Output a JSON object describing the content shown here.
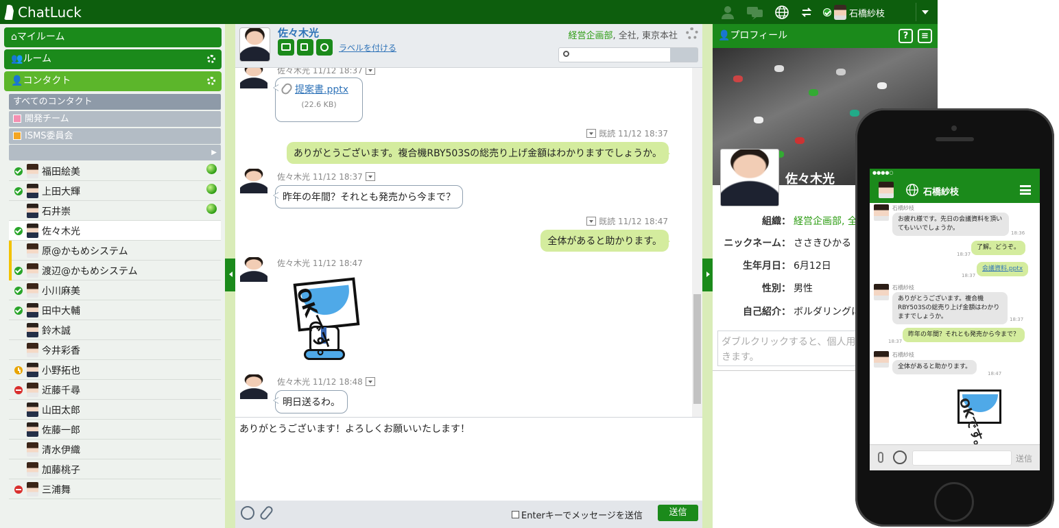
{
  "app": {
    "title": "ChatLuck"
  },
  "topbar": {
    "user_name": "石橋紗枝"
  },
  "sidebar": {
    "my_room": "マイルーム",
    "room": "ルーム",
    "contacts": "コンタクト",
    "groups": [
      {
        "label": "すべてのコンタクト",
        "color": "#8e9aa8"
      },
      {
        "label": "開発チーム",
        "color": "#f48fb1"
      },
      {
        "label": "ISMS委員会",
        "color": "#f5a623"
      }
    ],
    "contact_list": [
      {
        "name": "福田絵美",
        "status": "ok",
        "online": true,
        "female": true
      },
      {
        "name": "上田大輝",
        "status": "ok",
        "online": true,
        "female": false
      },
      {
        "name": "石井崇",
        "status": "",
        "online": true,
        "female": false
      },
      {
        "name": "佐々木光",
        "status": "ok",
        "online": false,
        "female": false,
        "selected": true
      },
      {
        "name": "原@かもめシステム",
        "status": "",
        "online": false,
        "female": true,
        "external": true
      },
      {
        "name": "渡辺@かもめシステム",
        "status": "ok",
        "online": false,
        "female": true,
        "external": true
      },
      {
        "name": "小川麻美",
        "status": "ok",
        "online": false,
        "female": true
      },
      {
        "name": "田中大輔",
        "status": "ok",
        "online": false,
        "female": false
      },
      {
        "name": "鈴木誠",
        "status": "",
        "online": false,
        "female": false
      },
      {
        "name": "今井彩香",
        "status": "",
        "online": false,
        "female": true
      },
      {
        "name": "小野拓也",
        "status": "away",
        "online": false,
        "female": false
      },
      {
        "name": "近藤千尋",
        "status": "busy",
        "online": false,
        "female": true
      },
      {
        "name": "山田太郎",
        "status": "",
        "online": false,
        "female": false
      },
      {
        "name": "佐藤一郎",
        "status": "",
        "online": false,
        "female": false
      },
      {
        "name": "清水伊織",
        "status": "",
        "online": false,
        "female": true
      },
      {
        "name": "加藤桃子",
        "status": "",
        "online": false,
        "female": true
      },
      {
        "name": "三浦舞",
        "status": "busy",
        "online": false,
        "female": true
      }
    ]
  },
  "chat": {
    "name": "佐々木光",
    "label_link": "ラベルを付ける",
    "org_dept": "経営企画部",
    "org_rest": ", 全社, 東京本社",
    "messages": {
      "m0_meta": "佐々木光 11/12 18:37",
      "file_name": "提案書.pptx",
      "file_size": "(22.6 KB)",
      "r1_meta": "既読 11/12 18:37",
      "r1_text": "ありがとうございます。複合機RBY503Sの総売り上げ金額はわかりますでしょうか。",
      "m2_meta": "佐々木光 11/12 18:37",
      "m2_text": "昨年の年間？それとも発売から今まで？",
      "r3_meta": "既読 11/12 18:47",
      "r3_text": "全体があると助かります。",
      "m4_meta": "佐々木光 11/12 18:47",
      "sticker_text": "OKです。",
      "m5_meta": "佐々木光 11/12 18:48",
      "m5_text": "明日送るわ。"
    },
    "input_value": "ありがとうございます！よろしくお願いいたします！",
    "enter_to_send": "Enterキーでメッセージを送信",
    "send": "送信"
  },
  "profile": {
    "header": "プロフィール",
    "name": "佐々木光",
    "rows": [
      {
        "k": "組織：",
        "v": "経営企画部, 全"
      },
      {
        "k": "ニックネーム：",
        "v": "ささきひかる"
      },
      {
        "k": "生年月日：",
        "v": "6月12日"
      },
      {
        "k": "性別：",
        "v": "男性"
      },
      {
        "k": "自己紹介：",
        "v": "ボルダリングに"
      }
    ],
    "memo_placeholder": "ダブルクリックすると、個人用\nきます。"
  },
  "phone": {
    "title": "石橋紗枝",
    "n1": "石橋紗枝",
    "b1": "お疲れ様です。先日の会議資料を頂いてもいいでしょうか。",
    "t1": "18:36",
    "r1": "了解。どうぞ。",
    "t2": "18:37",
    "r2": "会議資料.pptx",
    "t3": "18:37",
    "n2": "石橋紗枝",
    "b2": "ありがとうございます。複合機RBY503Sの総売り上げ金額はわかりますでしょうか。",
    "t4": "18:37",
    "r3": "昨年の年間？それとも発売から今まで？",
    "t5": "18:37",
    "n3": "石橋紗枝",
    "b3": "全体があると助かります。",
    "t6": "18:47",
    "send": "送信"
  }
}
